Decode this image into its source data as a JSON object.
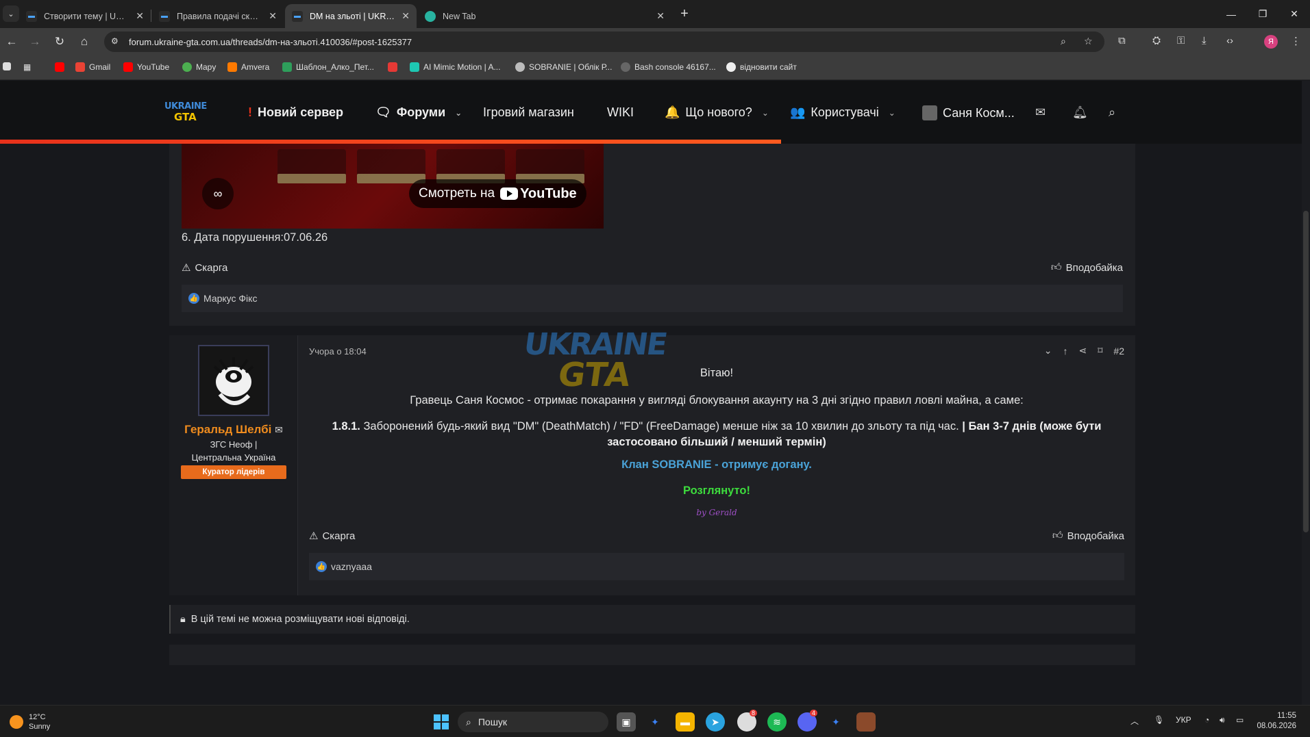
{
  "browser": {
    "tabs": [
      {
        "label": "Створити тему | UKRAINE GTA",
        "active": false
      },
      {
        "label": "Правила подачі скарги чи оск...",
        "active": false
      },
      {
        "label": "DM на зльоті | UKRAINE GTA -",
        "active": true
      },
      {
        "label": "New Tab",
        "active": false
      }
    ],
    "url": "forum.ukraine-gta.com.ua/threads/dm-на-зльоті.410036/#post-1625377",
    "profile_initial": "Я",
    "bookmarks": [
      "Gmail",
      "YouTube",
      "Мapy",
      "Amvera",
      "Шаблон_Алко_Пет...",
      "AI Mimic Motion | A...",
      "SOBRANIE | Облік Р...",
      "Bash console 46167...",
      "відновити сайт"
    ]
  },
  "header": {
    "logo_top": "UKRAINE",
    "logo_bottom": "GTA",
    "nav": {
      "new_server": "Новий сервер",
      "forums": "Форуми",
      "shop": "Ігровий магазин",
      "wiki": "WIKI",
      "whats_new": "Що нового?",
      "users": "Користувачі",
      "account": "Саня Косм..."
    }
  },
  "post1": {
    "video_watch_label": "Смотреть на",
    "video_brand": "YouTube",
    "date_line": "6. Дата порушення:07.06.26",
    "report_label": "Скарга",
    "like_label": "Вподобайка",
    "reaction_user": "Маркус Фікс"
  },
  "post2": {
    "author": "Геральд Шелбі",
    "author_title_line1": "ЗГС Неоф |",
    "author_title_line2": "Центральна Україна",
    "author_badge": "Куратор лідерів",
    "timestamp": "Учора о 18:04",
    "post_number": "#2",
    "greeting": "Вітаю!",
    "verdict_line": "Гравець Саня Космос - отримає покарання у вигляді блокування акаунту на 3 дні згідно правил ловлі майна, а саме:",
    "rule_number": "1.8.1.",
    "rule_text": "Заборонений будь-який вид \"DM\" (DeathMatch) / \"FD\" (FreeDamage) менше ніж за 10 хвилин до зльоту та під час.",
    "rule_penalty": "| Бан 3-7 днів (може бути застосовано більший / менший термін)",
    "clan_line": "Клан SOBRANIE - отримує догану.",
    "status": "Розглянуто!",
    "signature": "by Gerald",
    "report_label": "Скарга",
    "like_label": "Вподобайка",
    "reaction_user": "vaznyaaa"
  },
  "thread": {
    "locked_message": "В цій темі не можна розміщувати нові відповіді."
  },
  "taskbar": {
    "temperature": "12°C",
    "weather": "Sunny",
    "search_placeholder": "Пошук",
    "language": "УКР",
    "time": "11:55",
    "date": "08.06.2026",
    "chrome_badge": "8",
    "discord_badge": "4"
  },
  "colors": {
    "accent_orange": "#e86b1c",
    "header_progress": "#e8311b",
    "clan_blue": "#4aa3d8",
    "status_green": "#3ddc3d",
    "author_orange": "#f08c1e"
  }
}
